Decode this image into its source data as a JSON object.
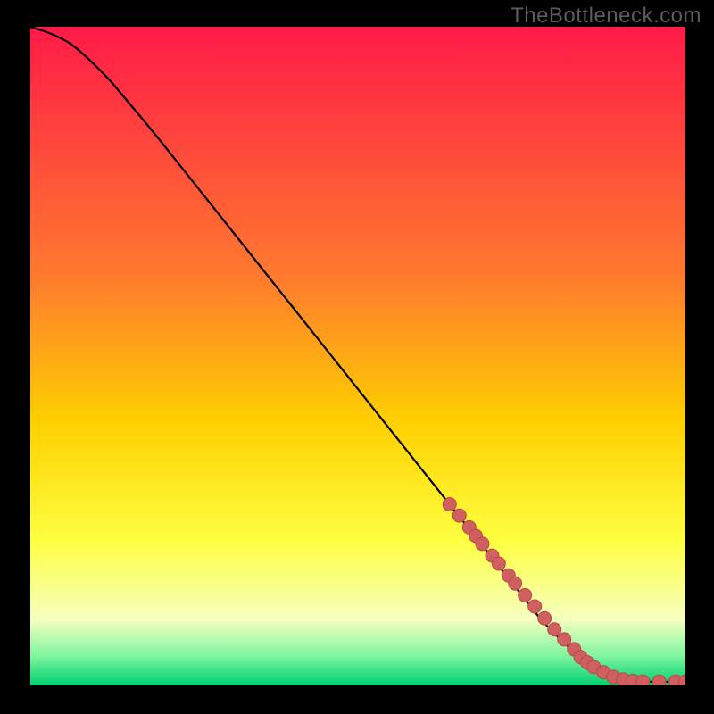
{
  "watermark": "TheBottleneck.com",
  "colors": {
    "bg": "#000000",
    "curve": "#000000",
    "marker_fill": "#d06060",
    "marker_stroke": "#b84848",
    "grad_top": "#ff1a48",
    "grad_upper": "#ff7a2e",
    "grad_mid": "#ffd000",
    "grad_yellow": "#ffff40",
    "grad_pale": "#f5ffc0",
    "grad_green_light": "#80f5a0",
    "grad_green": "#00d070"
  },
  "chart_data": {
    "type": "line",
    "title": "",
    "xlabel": "",
    "ylabel": "",
    "xlim": [
      0,
      100
    ],
    "ylim": [
      0,
      100
    ],
    "curve": {
      "x": [
        0,
        3,
        6,
        9,
        12,
        15,
        20,
        30,
        40,
        50,
        60,
        68,
        74,
        78,
        82,
        86,
        90,
        94,
        100
      ],
      "y": [
        100,
        99,
        97.5,
        95,
        92,
        88.5,
        82.5,
        70,
        57.5,
        45,
        32.5,
        22.5,
        15,
        10,
        6,
        3,
        1.2,
        0.6,
        0.6
      ]
    },
    "markers": {
      "x": [
        64,
        65.5,
        67,
        68,
        69,
        70.5,
        71.5,
        73,
        74,
        75.5,
        77,
        78.5,
        80,
        81.5,
        83,
        84,
        85,
        86,
        87.5,
        89,
        90.5,
        92,
        93.5,
        96,
        98.5,
        100
      ],
      "y": [
        27.5,
        25.8,
        24,
        22.7,
        21.5,
        19.7,
        18.5,
        16.7,
        15.5,
        13.7,
        12,
        10.2,
        8.5,
        7,
        5.5,
        4.3,
        3.5,
        2.8,
        2,
        1.3,
        0.9,
        0.7,
        0.6,
        0.6,
        0.6,
        0.6
      ]
    }
  }
}
